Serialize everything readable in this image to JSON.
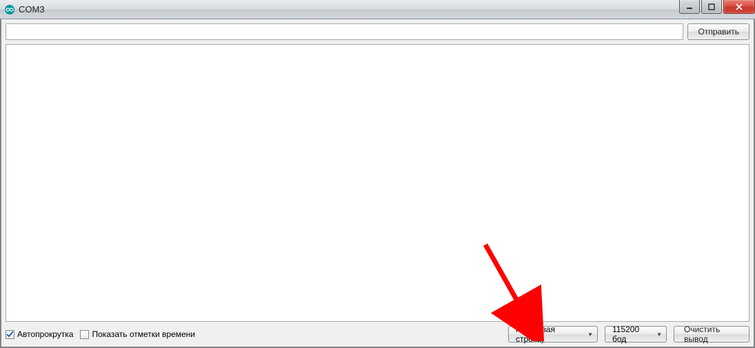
{
  "window": {
    "title": "COM3"
  },
  "toolbar": {
    "send_label": "Отправить",
    "input_value": ""
  },
  "bottom": {
    "autoscroll_label": "Автопрокрутка",
    "autoscroll_checked": true,
    "timestamp_label": "Показать отметки времени",
    "timestamp_checked": false,
    "line_ending_selected": "NL (Новая строка)",
    "baud_selected": "115200 бод",
    "clear_label": "Очистить вывод"
  },
  "annotation": {
    "arrow_color": "#ff0000"
  }
}
